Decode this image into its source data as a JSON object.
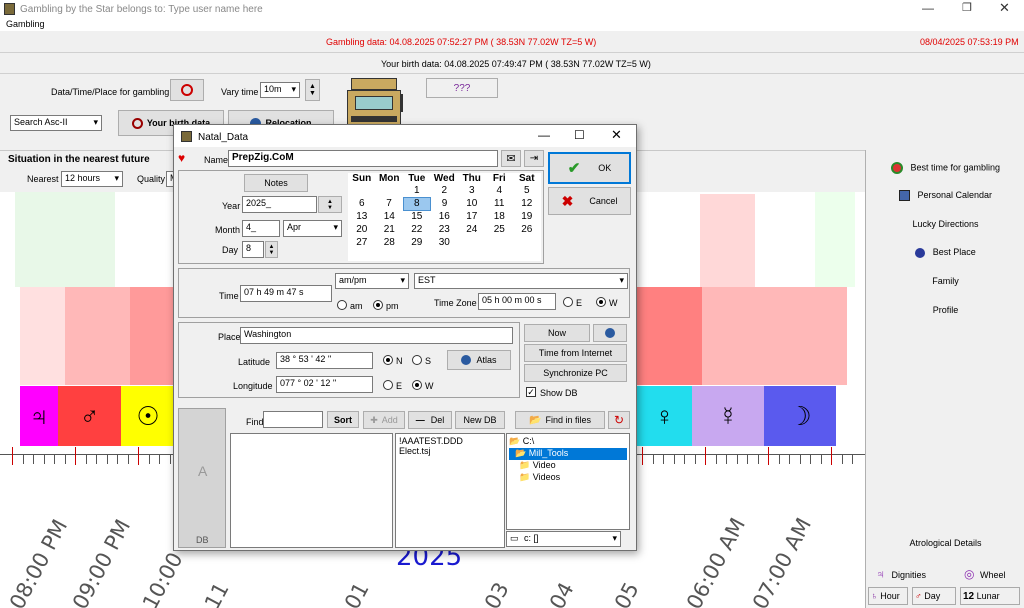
{
  "window": {
    "title": "Gambling by the Star belongs to: Type user name here",
    "menu": "Gambling"
  },
  "status": {
    "gambling_data": "Gambling data: 04.08.2025  07:52:27 PM ( 38.53N  77.02W TZ=5 W)",
    "now": "08/04/2025 07:53:19 PM",
    "birth_data": "Your birth data: 04.08.2025  07:49:47 PM ( 38.53N  77.02W TZ=5 W)"
  },
  "toolbar": {
    "data_label": "Data/Time/Place for gambling",
    "vary_label": "Vary time",
    "vary_value": "10m",
    "qqq": "???",
    "search_value": "Search Asc-II",
    "birth_btn": "Your birth data",
    "relocation_btn": "Relocation"
  },
  "situation": {
    "title": "Situation in the nearest future",
    "nearest_label": "Nearest",
    "nearest_value": "12 hours",
    "quality_label": "Quality",
    "quality_value": "M"
  },
  "right_panel": {
    "items": [
      "Best time for gambling",
      "Personal Calendar",
      "Lucky Directions",
      "Best Place",
      "Family",
      "Profile"
    ],
    "astro_details": "Atrological Details",
    "dignities": "Dignities",
    "wheel": "Wheel",
    "hour": "Hour",
    "day": "Day",
    "lunar_num": "12",
    "lunar": "Lunar"
  },
  "chart_bar": {
    "year": "2025",
    "left_glyphs": [
      "♃",
      "♂",
      "☉"
    ],
    "right_glyphs": [
      "♀",
      "☿",
      "☽"
    ],
    "times": [
      "08:00 PM",
      "09:00 PM",
      "10:00 PM",
      "11",
      "01",
      "03",
      "04",
      "05",
      "06:00 AM",
      "07:00 AM"
    ]
  },
  "dialog": {
    "title": "Natal_Data",
    "name_label": "Name",
    "name_value": "PrepZig.CoM",
    "notes_btn": "Notes",
    "year_label": "Year",
    "year_value": "2025_",
    "month_label": "Month",
    "month_value": "4_",
    "month_name": "Apr",
    "day_label": "Day",
    "day_value": "8",
    "ok": "OK",
    "cancel": "Cancel",
    "calendar": {
      "headers": [
        "Sun",
        "Mon",
        "Tue",
        "Wed",
        "Thu",
        "Fri",
        "Sat"
      ],
      "rows": [
        [
          "",
          "",
          "1",
          "2",
          "3",
          "4",
          "5"
        ],
        [
          "6",
          "7",
          "8",
          "9",
          "10",
          "11",
          "12"
        ],
        [
          "13",
          "14",
          "15",
          "16",
          "17",
          "18",
          "19"
        ],
        [
          "20",
          "21",
          "22",
          "23",
          "24",
          "25",
          "26"
        ],
        [
          "27",
          "28",
          "29",
          "30",
          "",
          "",
          ""
        ]
      ],
      "selected": "8"
    },
    "ampm_select": "am/pm",
    "tz_select": "EST",
    "time_label": "Time",
    "time_value": "07  h 49 m  47 s",
    "am": "am",
    "pm": "pm",
    "tz_label": "Time Zone",
    "tz_value": "05  h 00 m  00 s",
    "e": "E",
    "w": "W",
    "place_label": "Place",
    "place_value": "Washington",
    "lat_label": "Latitude",
    "lat_value": "38  ° 53 ' 42 ''",
    "n": "N",
    "s": "S",
    "atlas": "Atlas",
    "lon_label": "Longitude",
    "lon_value": "077  ° 02 ' 12 ''",
    "now_btn": "Now",
    "time_internet": "Time from Internet",
    "sync_pc": "Synchronize PC",
    "show_db": "Show DB",
    "find_label": "Find",
    "sort": "Sort",
    "add": "Add",
    "del": "Del",
    "new_db": "New DB",
    "find_files": "Find in files",
    "side_letter": "A",
    "db_label": "DB",
    "files": [
      "!AAATEST.DDD",
      "Elect.tsj"
    ],
    "folders": [
      "C:\\",
      "Mill_Tools",
      "Video",
      "Videos"
    ],
    "drive": "c: []"
  },
  "colors": {
    "jupiter_bg": "#ff00ff",
    "mars_bg": "#ff4040",
    "sun_bg": "#ffff00",
    "venus_bg": "#22ddee",
    "mercury_bg": "#c8a8f0",
    "moon_bg": "#5a5aee",
    "status_red": "#e00000",
    "selection": "#0078d7"
  }
}
